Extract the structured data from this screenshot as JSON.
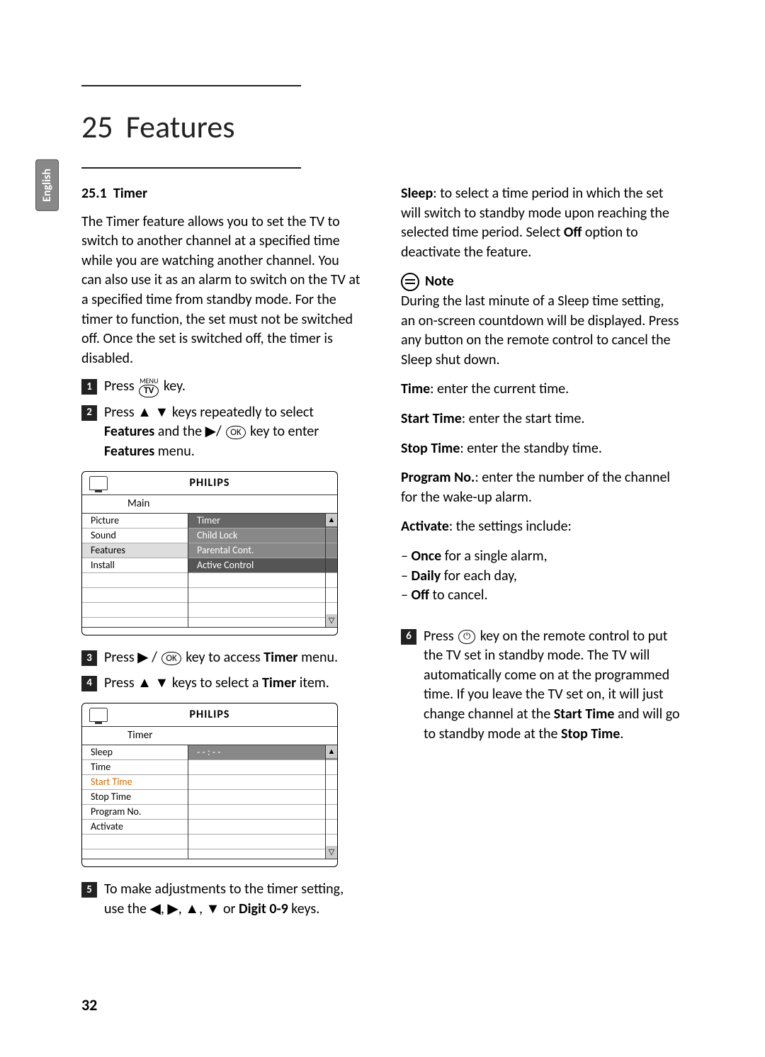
{
  "language_tab": "English",
  "chapter_number": "25",
  "chapter_title": "Features",
  "section": {
    "number": "25.1",
    "title": "Timer"
  },
  "intro_paragraph": "The Timer feature allows you to set the TV to switch to another channel at a specified time while you are watching another channel. You can also use it as an alarm to switch on the TV at a specified time from standby mode. For the timer to function, the set must not be switched off. Once the set is switched off, the timer is disabled.",
  "steps": {
    "s1_a": "Press ",
    "s1_b": " key.",
    "s2_a": "Press ",
    "s2_b": " keys repeatedly to select ",
    "s2_features": "Features",
    "s2_c": " and the ",
    "s2_d": " key to enter ",
    "s2_features2": "Features",
    "s2_e": " menu.",
    "s3_a": "Press ",
    "s3_b": " key to access ",
    "s3_timer": "Timer",
    "s3_c": " menu.",
    "s4_a": "Press ",
    "s4_b": " keys to select a ",
    "s4_timer": "Timer",
    "s4_c": " item.",
    "s5_a": "To make adjustments to the timer setting, use the ",
    "s5_b": " or ",
    "s5_digit": "Digit 0-9",
    "s5_c": " keys.",
    "s6_a": "Press ",
    "s6_b": " key on the remote control to put the TV set in standby mode. The TV will automatically come on at the programmed time. If you leave the TV set on, it will just change channel at the ",
    "s6_start": "Start Time",
    "s6_c": " and will go to standby mode at the ",
    "s6_stop": "Stop Time",
    "s6_d": "."
  },
  "osd_main": {
    "brand": "PHILIPS",
    "title": "Main",
    "left": [
      "Picture",
      "Sound",
      "Features",
      "Install"
    ],
    "right": [
      "Timer",
      "Child Lock",
      "Parental Cont.",
      "Active Control"
    ]
  },
  "osd_timer": {
    "brand": "PHILIPS",
    "title": "Timer",
    "left": [
      "Sleep",
      "Time",
      "Start Time",
      "Stop Time",
      "Program No.",
      "Activate"
    ],
    "right_value": "- - : - -"
  },
  "right_col": {
    "sleep_label": "Sleep",
    "sleep_text": ": to select a time period in which the set will switch to standby mode upon reaching the selected time period. Select ",
    "off": "Off",
    "sleep_text2": " option to deactivate the feature.",
    "note_label": "Note",
    "note_text": "During the last minute of a Sleep time setting, an on-screen countdown will be displayed. Press any button on the remote control to cancel the Sleep shut down.",
    "time_label": "Time",
    "time_text": ": enter the current time.",
    "start_label": "Start Time",
    "start_text": ": enter the start time.",
    "stop_label": "Stop Time",
    "stop_text": ": enter the standby time.",
    "prog_label": "Program No.",
    "prog_text": ": enter the number of the channel for the wake-up alarm.",
    "activate_label": "Activate",
    "activate_text": ": the settings include:",
    "b_once_label": "Once",
    "b_once": " for a single alarm,",
    "b_daily_label": "Daily",
    "b_daily": " for each day,",
    "b_off_label": "Off",
    "b_off": " to cancel."
  },
  "keys": {
    "menu": "MENU",
    "tv": "TV",
    "ok": "OK",
    "up": "▲",
    "down": "▼",
    "left": "◀",
    "right": "▶",
    "power": "⏻"
  },
  "page_number": "32"
}
